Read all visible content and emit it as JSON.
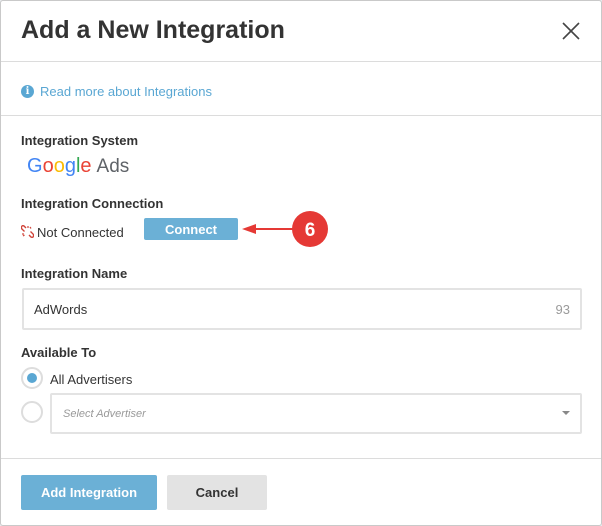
{
  "dialog": {
    "title": "Add a New Integration",
    "close_icon": "close-icon"
  },
  "read_more": {
    "icon": "info-icon",
    "text": "Read more about Integrations"
  },
  "integration_system": {
    "label": "Integration System",
    "logo_word": [
      "G",
      "o",
      "o",
      "g",
      "l",
      "e"
    ],
    "logo_word_colors": [
      "#4285F4",
      "#EA4335",
      "#FBBC05",
      "#4285F4",
      "#34A853",
      "#EA4335"
    ],
    "logo_suffix": "Ads"
  },
  "integration_connection": {
    "label": "Integration Connection",
    "status_icon": "unlink-icon",
    "status_text": "Not Connected",
    "connect_label": "Connect",
    "callout_number": "6"
  },
  "integration_name": {
    "label": "Integration Name",
    "value": "AdWords",
    "remaining_chars": "93"
  },
  "available_to": {
    "label": "Available To",
    "option_all": "All Advertisers",
    "select_placeholder": "Select Advertiser"
  },
  "footer": {
    "primary_label": "Add Integration",
    "secondary_label": "Cancel"
  },
  "colors": {
    "accent": "#5aa7d3",
    "button": "#6bb0d6",
    "callout": "#e53935",
    "unlink": "#d0443a"
  }
}
